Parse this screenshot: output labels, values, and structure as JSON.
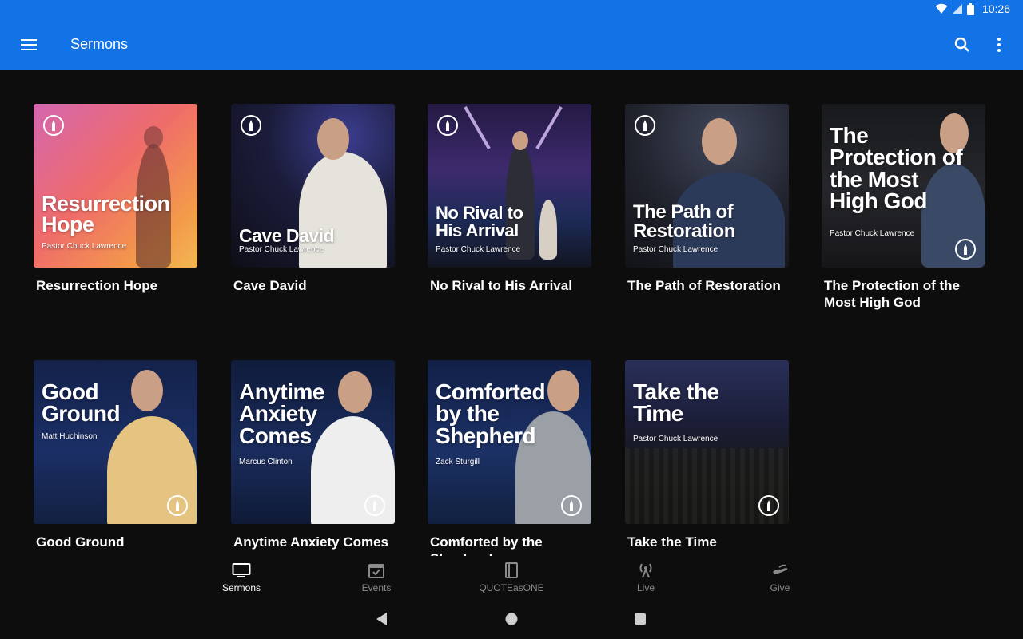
{
  "status": {
    "time": "10:26"
  },
  "app_bar": {
    "title": "Sermons"
  },
  "sermons": [
    {
      "label": "Resurrection Hope",
      "thumb_title": "Resurrection Hope",
      "thumb_sub": "Pastor Chuck Lawrence"
    },
    {
      "label": "Cave David",
      "thumb_title": "Cave David",
      "thumb_sub": "Pastor Chuck Lawrence"
    },
    {
      "label": "No Rival to His Arrival",
      "thumb_title": "No Rival to His Arrival",
      "thumb_sub": "Pastor Chuck Lawrence"
    },
    {
      "label": "The Path of Restoration",
      "thumb_title": "The Path of Restoration",
      "thumb_sub": "Pastor Chuck Lawrence"
    },
    {
      "label": "The Protection of the Most High God",
      "thumb_title": "The Protection of the Most High God",
      "thumb_sub": "Pastor Chuck Lawrence"
    },
    {
      "label": "Good Ground",
      "thumb_title": "Good Ground",
      "thumb_sub": "Matt Huchinson"
    },
    {
      "label": "Anytime Anxiety Comes",
      "thumb_title": "Anytime Anxiety Comes",
      "thumb_sub": "Marcus Clinton"
    },
    {
      "label": "Comforted by the Shepherd",
      "thumb_title": "Comforted by the Shepherd",
      "thumb_sub": "Zack Sturgill"
    },
    {
      "label": "Take the Time",
      "thumb_title": "Take the Time",
      "thumb_sub": "Pastor Chuck Lawrence"
    }
  ],
  "bottom_nav": [
    {
      "label": "Sermons",
      "icon": "tv-icon"
    },
    {
      "label": "Events",
      "icon": "calendar-icon"
    },
    {
      "label": "QUOTEasONE",
      "icon": "book-icon"
    },
    {
      "label": "Live",
      "icon": "broadcast-icon"
    },
    {
      "label": "Give",
      "icon": "hand-icon"
    }
  ],
  "colors": {
    "accent": "#1273e6",
    "background": "#0d0d0e",
    "inactive": "#8a8a8a"
  }
}
